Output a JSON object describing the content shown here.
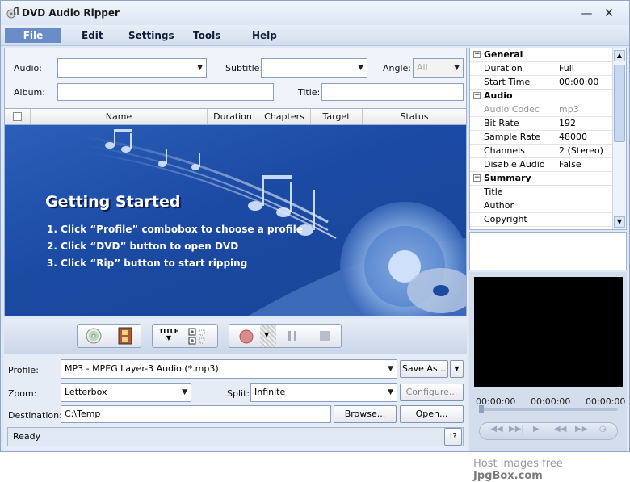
{
  "window": {
    "title": "DVD Audio Ripper",
    "minimize_glyph": "—",
    "close_glyph": "✕"
  },
  "menu": {
    "items": [
      "File",
      "Edit",
      "Settings",
      "Tools",
      "Help"
    ]
  },
  "filters": {
    "audio_label": "Audio:",
    "audio_value": "",
    "subtitle_label": "Subtitle:",
    "subtitle_value": "",
    "angle_label": "Angle:",
    "angle_value": "All",
    "album_label": "Album:",
    "album_value": "",
    "title_label": "Title:",
    "title_value": ""
  },
  "list": {
    "columns": [
      "Name",
      "Duration",
      "Chapters",
      "Target",
      "Status"
    ]
  },
  "getting_started": {
    "heading": "Getting Started",
    "steps": [
      "1. Click “Profile” combobox to choose a profile",
      "2. Click “DVD” button to open DVD",
      "3. Click “Rip” button to start ripping"
    ]
  },
  "toolbar": {
    "title_button_label": "TITLE",
    "icons": [
      "dvd-disc-icon",
      "film-icon",
      "title-icon",
      "select-all-icon",
      "record-icon",
      "pause-icon",
      "stop-icon"
    ]
  },
  "settings": {
    "profile_label": "Profile:",
    "profile_value": "MP3 - MPEG Layer-3 Audio  (*.mp3)",
    "save_as_label": "Save As...",
    "zoom_label": "Zoom:",
    "zoom_value": "Letterbox",
    "split_label": "Split:",
    "split_value": "Infinite",
    "configure_label": "Configure...",
    "destination_label": "Destination:",
    "destination_value": "C:\\Temp",
    "browse_label": "Browse...",
    "open_label": "Open..."
  },
  "status": {
    "text": "Ready",
    "help_label": "!?"
  },
  "properties": {
    "rows": [
      {
        "type": "cat",
        "name": "General"
      },
      {
        "type": "prop",
        "name": "Duration",
        "value": "Full"
      },
      {
        "type": "prop",
        "name": "Start Time",
        "value": "00:00:00"
      },
      {
        "type": "cat",
        "name": "Audio"
      },
      {
        "type": "dim",
        "name": "Audio Codec",
        "value": "mp3"
      },
      {
        "type": "prop",
        "name": "Bit Rate",
        "value": "192"
      },
      {
        "type": "prop",
        "name": "Sample Rate",
        "value": "48000"
      },
      {
        "type": "prop",
        "name": "Channels",
        "value": "2 (Stereo)"
      },
      {
        "type": "prop",
        "name": "Disable Audio",
        "value": "False"
      },
      {
        "type": "cat",
        "name": "Summary"
      },
      {
        "type": "prop",
        "name": "Title",
        "value": ""
      },
      {
        "type": "prop",
        "name": "Author",
        "value": ""
      },
      {
        "type": "prop",
        "name": "Copyright",
        "value": ""
      }
    ]
  },
  "player": {
    "time_current": "00:00:00",
    "time_middle": "00:00:00",
    "time_total": "00:00:00"
  },
  "watermark": {
    "prefix": "Host images free ",
    "brand": "JpgBox.com"
  },
  "colors": {
    "accent": "#6a8cc7",
    "banner": "#1f4fa8",
    "video": "#000000"
  }
}
